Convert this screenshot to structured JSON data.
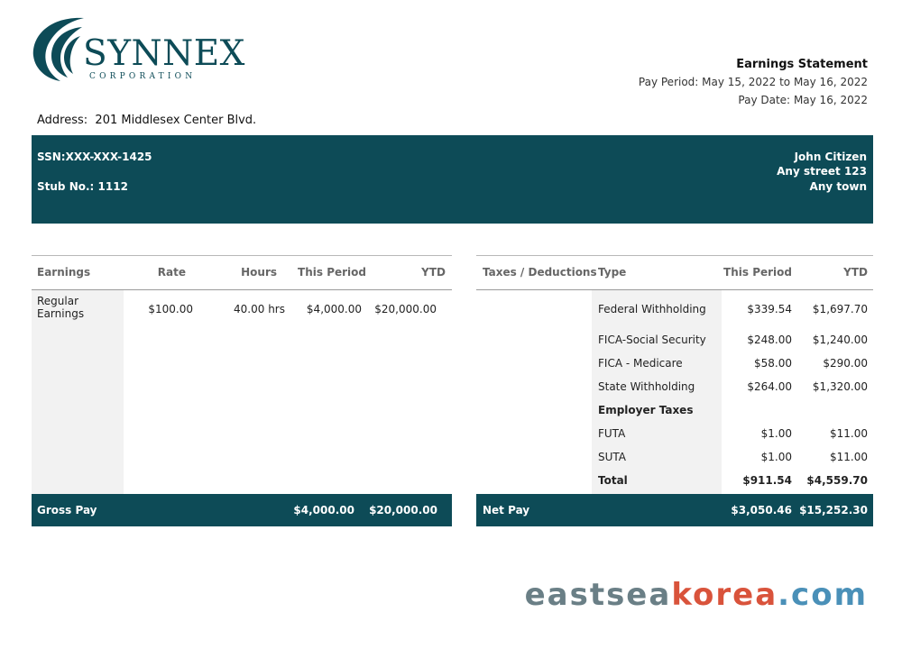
{
  "company": {
    "name": "SYNNEX",
    "subtitle": "CORPORATION"
  },
  "statement": {
    "title": "Earnings Statement",
    "pay_period_label": "Pay Period:",
    "pay_period_start": "May 15, 2022",
    "pay_period_to": "to",
    "pay_period_end": "May 16, 2022",
    "pay_date_label": "Pay Date:",
    "pay_date": "May 16, 2022"
  },
  "address": {
    "label": "Address:",
    "value": "201 Middlesex Center Blvd."
  },
  "employee": {
    "ssn_label": "SSN:",
    "ssn": "XXX-XXX-1425",
    "stub_label": "Stub No.:",
    "stub": "1112",
    "name": "John Citizen",
    "street": "Any street 123",
    "town": "Any town"
  },
  "earnings": {
    "headers": [
      "Earnings",
      "Rate",
      "Hours",
      "This Period",
      "YTD"
    ],
    "rows": [
      {
        "label_line1": "Regular",
        "label_line2": "Earnings",
        "rate": "$100.00",
        "hours": "40.00 hrs",
        "this_period": "$4,000.00",
        "ytd": "$20,000.00"
      }
    ],
    "gross_label": "Gross Pay",
    "gross_this_period": "$4,000.00",
    "gross_ytd": "$20,000.00"
  },
  "taxes": {
    "headers": [
      "Taxes / Deductions",
      "Type",
      "This Period",
      "YTD"
    ],
    "rows": [
      {
        "type": "Federal Withholding",
        "this_period": "$339.54",
        "ytd": "$1,697.70"
      },
      {
        "type": "FICA-Social Security",
        "this_period": "$248.00",
        "ytd": "$1,240.00"
      },
      {
        "type": "FICA - Medicare",
        "this_period": "$58.00",
        "ytd": "$290.00"
      },
      {
        "type": "State Withholding",
        "this_period": "$264.00",
        "ytd": "$1,320.00"
      }
    ],
    "employer_taxes_label": "Employer Taxes",
    "employer_rows": [
      {
        "type": "FUTA",
        "this_period": "$1.00",
        "ytd": "$11.00"
      },
      {
        "type": "SUTA",
        "this_period": "$1.00",
        "ytd": "$11.00"
      }
    ],
    "total_label": "Total",
    "total_this_period": "$911.54",
    "total_ytd": "$4,559.70",
    "net_label": "Net Pay",
    "net_this_period": "$3,050.46",
    "net_ytd": "$15,252.30"
  },
  "watermark": {
    "part1": "eastsea",
    "part2": "korea",
    "part3": ".com"
  },
  "colors": {
    "brand": "#0d4b57",
    "shade": "#f2f2f2",
    "watermark_gray": "#6a7f86",
    "watermark_red": "#d9533b",
    "watermark_blue": "#4a90b8"
  }
}
